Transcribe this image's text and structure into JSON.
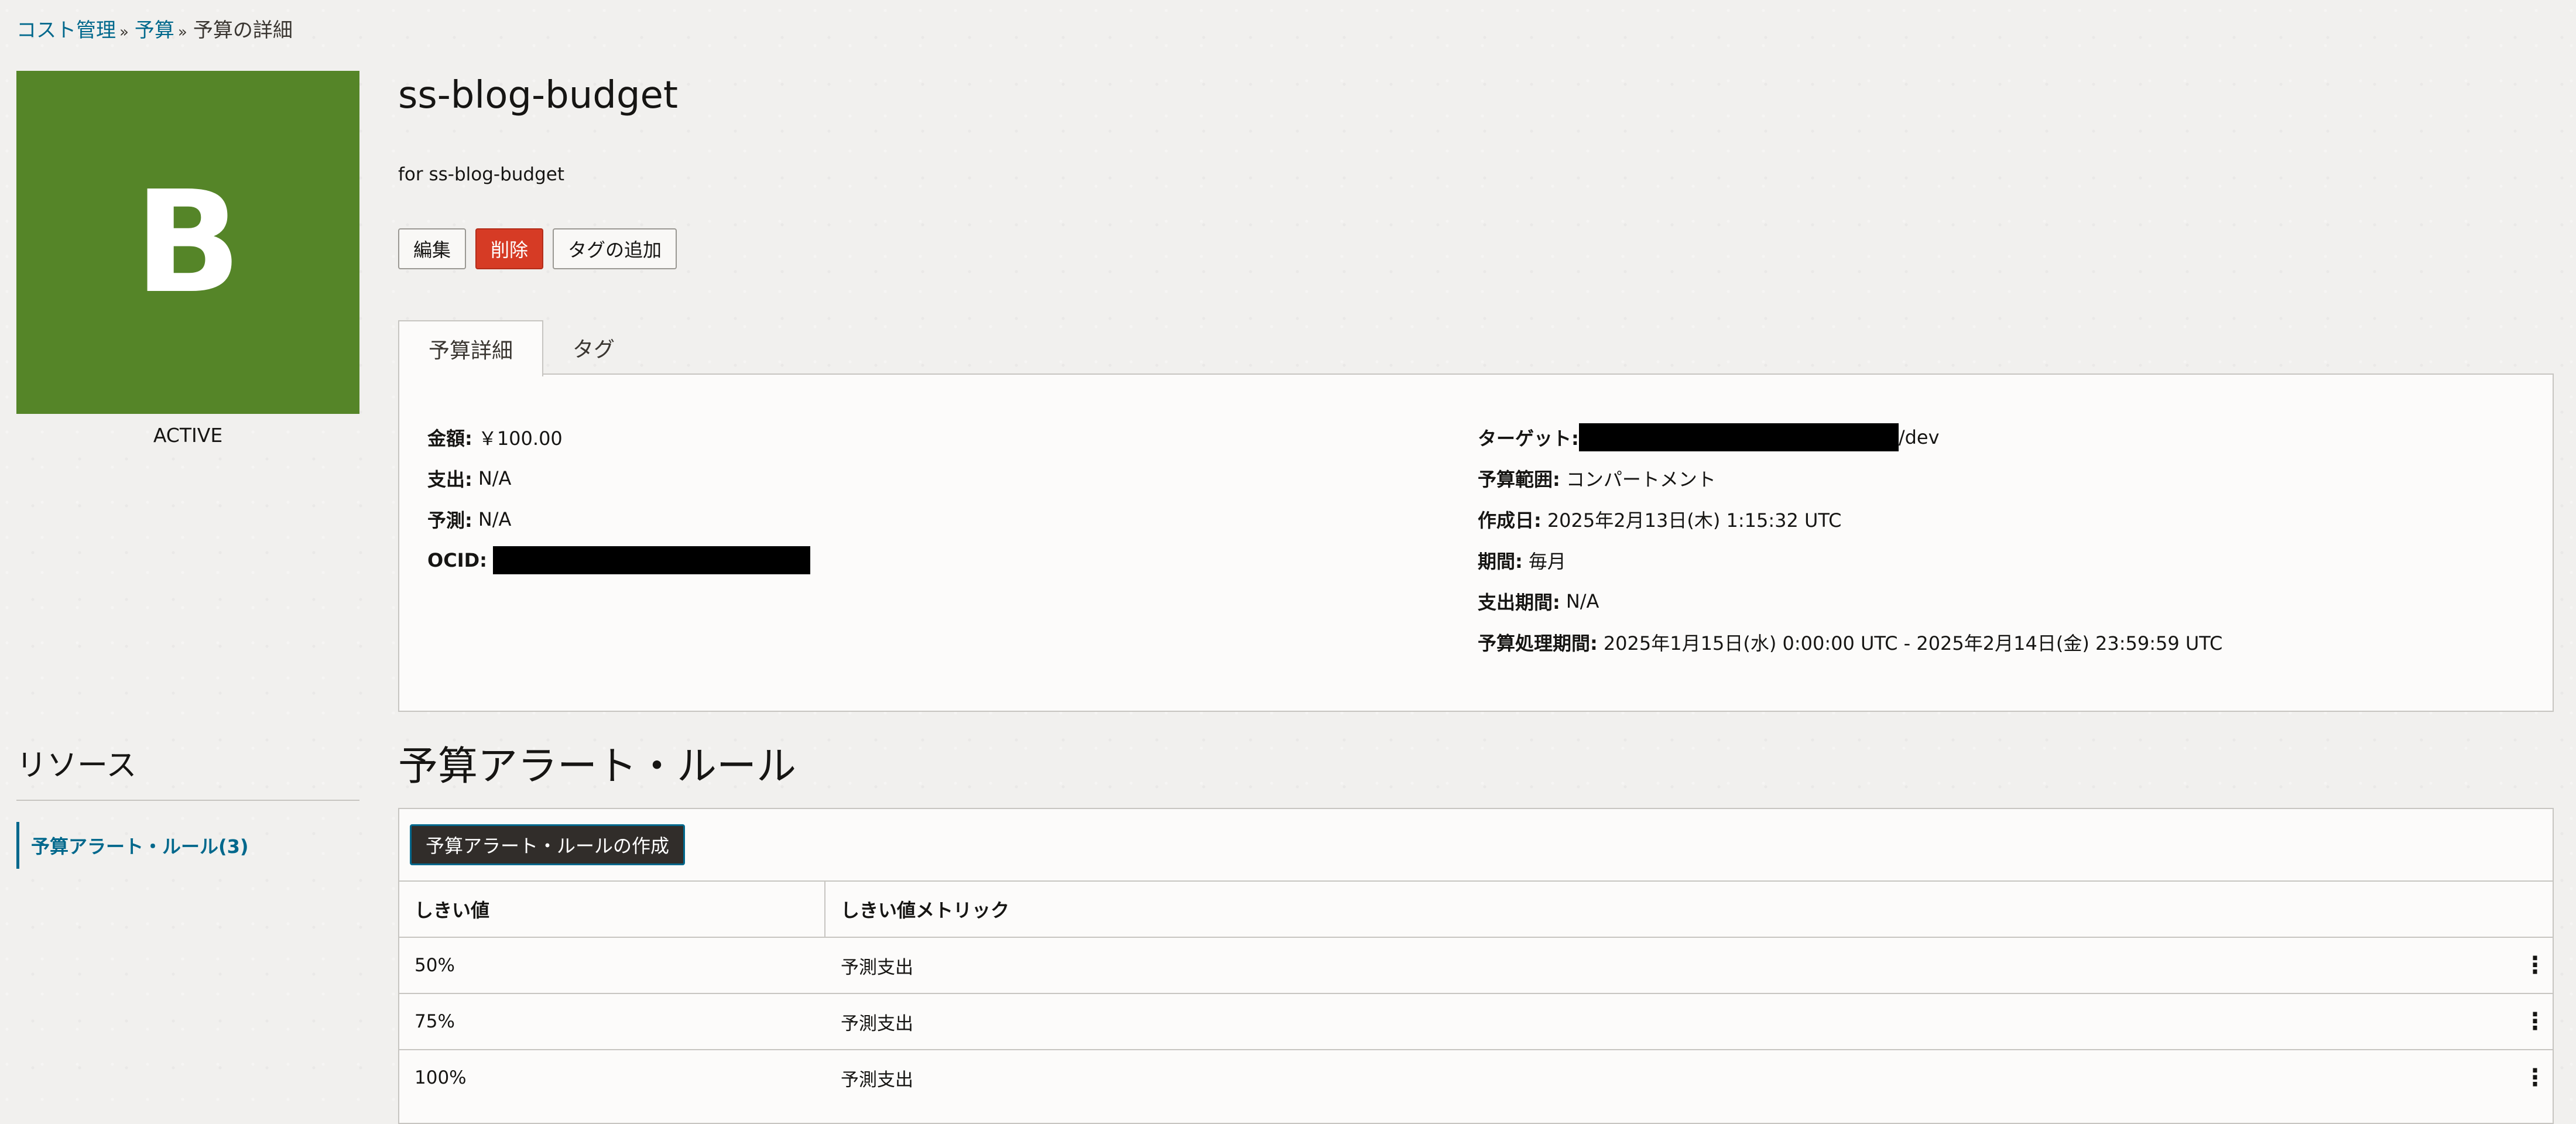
{
  "breadcrumb": {
    "item1": "コスト管理",
    "item2": "予算",
    "current": "予算の詳細",
    "sep": "»"
  },
  "resource": {
    "letter": "B",
    "state": "ACTIVE",
    "tile_color": "#558528"
  },
  "header": {
    "title": "ss-blog-budget",
    "description": "for ss-blog-budget"
  },
  "actions": {
    "edit": "編集",
    "delete": "削除",
    "add_tags": "タグの追加"
  },
  "tabs": {
    "details": "予算詳細",
    "tags": "タグ"
  },
  "details": {
    "amount_label": "金額:",
    "amount_value": "￥100.00",
    "spend_label": "支出:",
    "spend_value": "N/A",
    "forecast_label": "予測:",
    "forecast_value": "N/A",
    "ocid_label": "OCID:",
    "target_label": "ターゲット:",
    "target_suffix": "/dev",
    "scope_label": "予算範囲:",
    "scope_value": "コンパートメント",
    "created_label": "作成日:",
    "created_value": "2025年2月13日(木) 1:15:32 UTC",
    "period_label": "期間:",
    "period_value": "毎月",
    "spend_period_label": "支出期間:",
    "spend_period_value": "N/A",
    "processing_label": "予算処理期間:",
    "processing_value": "2025年1月15日(水) 0:00:00 UTC - 2025年2月14日(金) 23:59:59 UTC"
  },
  "resources": {
    "heading": "リソース",
    "link": "予算アラート・ルール(3)"
  },
  "alerts": {
    "title": "予算アラート・ルール",
    "create_button": "予算アラート・ルールの作成",
    "columns": [
      "しきい値",
      "しきい値メトリック"
    ],
    "rows": [
      {
        "threshold": "50%",
        "metric": "予測支出"
      },
      {
        "threshold": "75%",
        "metric": "予測支出"
      },
      {
        "threshold": "100%",
        "metric": "予測支出"
      }
    ]
  },
  "icons": {
    "row_menu": "kebab-menu-icon"
  },
  "colors": {
    "link": "#00688c",
    "danger": "#d63b25",
    "dark_button": "#312d2a"
  }
}
